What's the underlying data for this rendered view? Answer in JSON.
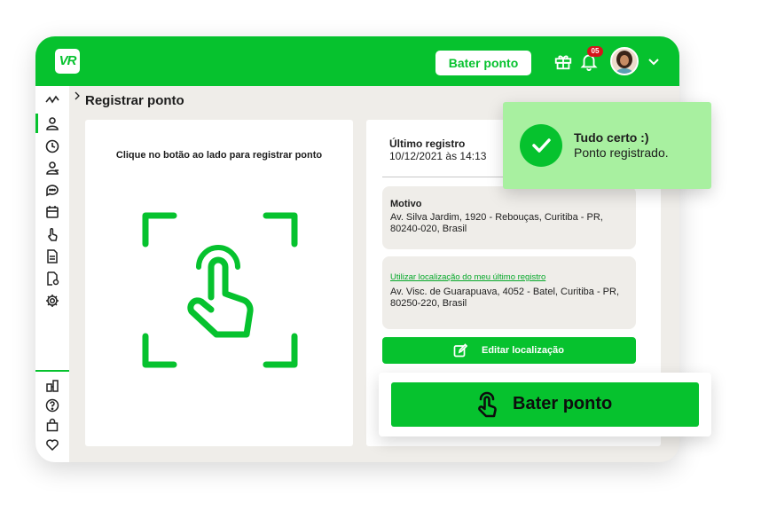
{
  "topbar": {
    "logo_text": "VR",
    "clock_button_label": "Bater ponto",
    "notification_count": "05",
    "brand_color": "#06c22e"
  },
  "sidebar": {
    "icons": [
      "activity-icon",
      "user-icon",
      "clock-icon",
      "user-group-icon",
      "chat-icon",
      "calendar-icon",
      "hand-pointer-icon",
      "document-icon",
      "document-settings-icon",
      "gear-icon"
    ],
    "bottom_icons": [
      "network-icon",
      "help-icon",
      "bag-icon",
      "heart-icon"
    ]
  },
  "page": {
    "title": "Registrar ponto"
  },
  "left_card": {
    "instruction": "Clique no botão ao lado para registrar ponto"
  },
  "right_card": {
    "last_record_title": "Último registro",
    "last_record_time": "10/12/2021 às 14:13",
    "reason_label": "Motivo",
    "reason_address": "Av. Silva Jardim, 1920 - Rebouças, Curitiba - PR, 80240-020, Brasil",
    "use_last_location_link": "Utilizar localização do meu último registro",
    "last_location_address": "Av. Visc. de Guarapuava, 4052 - Batel, Curitiba - PR, 80250-220, Brasil",
    "edit_location_label": "Editar localização"
  },
  "toast": {
    "title": "Tudo certo :)",
    "message": "Ponto registrado."
  },
  "main_action": {
    "label": "Bater ponto"
  }
}
